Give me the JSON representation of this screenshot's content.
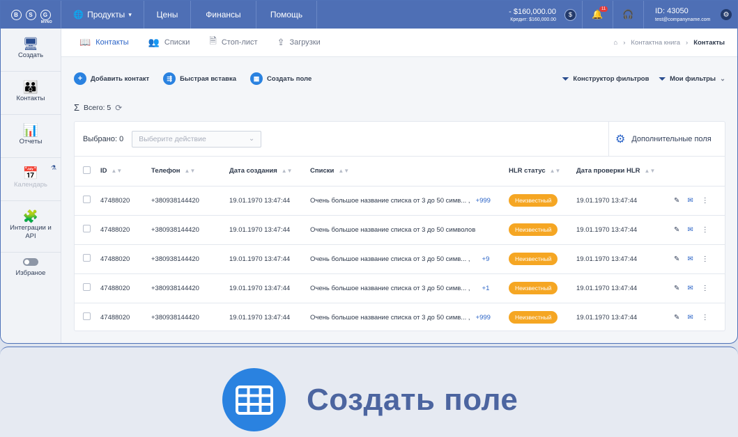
{
  "brand": {
    "letters": [
      "B",
      "S",
      "G"
    ],
    "sub": "MVNO"
  },
  "nav": {
    "products": "Продукты",
    "prices": "Цены",
    "finance": "Финансы",
    "help": "Помощь"
  },
  "account": {
    "balance": "- $160,000.00",
    "credit": "Кредит: $160,000.00",
    "notifications": "11",
    "id": "ID: 43050",
    "email": "test@companyname.com"
  },
  "sidebar": {
    "create": "Создать",
    "contacts": "Контакты",
    "reports": "Отчеты",
    "calendar": "Календарь",
    "integrations": "Интеграции и API",
    "favorites": "Избраное"
  },
  "tabs": {
    "contacts": "Контакты",
    "lists": "Списки",
    "stoplist": "Стоп-лист",
    "uploads": "Загрузки"
  },
  "breadcrumb": {
    "book": "Контактна книга",
    "current": "Контакты"
  },
  "actions": {
    "add_contact": "Добавить контакт",
    "quick_insert": "Быстрая вставка",
    "create_field": "Создать поле",
    "filter_builder": "Конструктор фильтров",
    "my_filters": "Мои фильтры"
  },
  "total": "Всего: 5",
  "table": {
    "selected": "Выбрано: 0",
    "select_placeholder": "Выберите действие",
    "extra_fields": "Дополнительные поля",
    "headers": {
      "id": "ID",
      "phone": "Телефон",
      "created": "Дата создания",
      "lists": "Списки",
      "hlr": "HLR статус",
      "hlr_date": "Дата проверки HLR"
    },
    "rows": [
      {
        "id": "47488020",
        "phone": "+380938144420",
        "created": "19.01.1970 13:47:44",
        "lists": "Очень большое название списка от 3 до 50 симв... ,",
        "more": "+999",
        "hlr": "Неизвестный",
        "hlr_date": "19.01.1970 13:47:44"
      },
      {
        "id": "47488020",
        "phone": "+380938144420",
        "created": "19.01.1970 13:47:44",
        "lists": "Очень большое название списка от 3 до 50 символов",
        "more": "",
        "hlr": "Неизвестный",
        "hlr_date": "19.01.1970 13:47:44"
      },
      {
        "id": "47488020",
        "phone": "+380938144420",
        "created": "19.01.1970 13:47:44",
        "lists": "Очень большое название списка от 3 до 50 симв... ,",
        "more": "+9",
        "hlr": "Неизвестный",
        "hlr_date": "19.01.1970 13:47:44"
      },
      {
        "id": "47488020",
        "phone": "+380938144420",
        "created": "19.01.1970 13:47:44",
        "lists": "Очень большое название списка от 3 до 50 симв... ,",
        "more": "+1",
        "hlr": "Неизвестный",
        "hlr_date": "19.01.1970 13:47:44"
      },
      {
        "id": "47488020",
        "phone": "+380938144420",
        "created": "19.01.1970 13:47:44",
        "lists": "Очень большое название списка от 3 до 50 симв... ,",
        "more": "+999",
        "hlr": "Неизвестный",
        "hlr_date": "19.01.1970 13:47:44"
      }
    ]
  },
  "banner": {
    "title": "Создать поле"
  },
  "colors": {
    "primary": "#4e6fb5",
    "accent": "#2a82e0",
    "hlr_unknown": "#f5a623"
  }
}
